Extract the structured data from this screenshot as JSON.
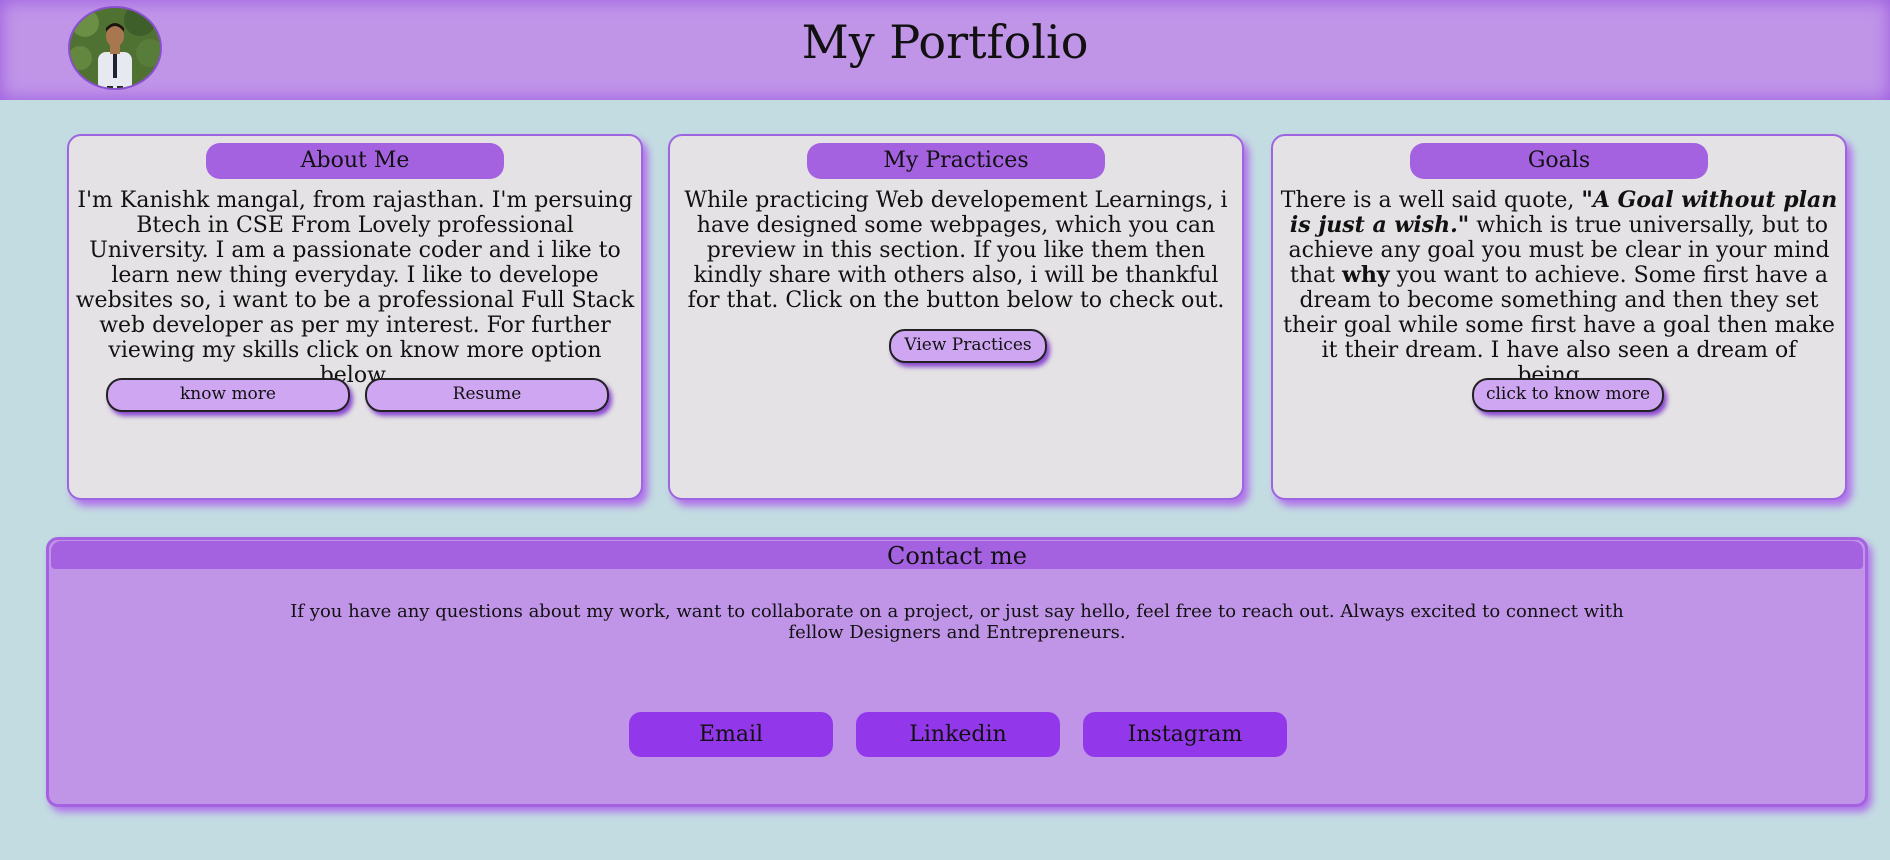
{
  "header": {
    "title": "My Portfolio"
  },
  "cards": [
    {
      "title": "About Me",
      "text": "I'm Kanishk mangal, from rajasthan. I'm persuing Btech in CSE From Lovely professional University. I am a passionate coder and i like to learn new thing everyday. I like to develope websites so, i want to be a professional Full Stack web developer as per my interest. For further viewing my skills click on know more option below.",
      "buttons": [
        "know more",
        "Resume"
      ]
    },
    {
      "title": "My Practices",
      "text": "While practicing Web developement Learnings, i have designed some webpages, which you can preview in this section. If you like them then kindly share with others also, i will be thankful for that. Click on the button below to check out.",
      "buttons": [
        "View Practices"
      ]
    },
    {
      "title": "Goals",
      "text_before": "There is a well said quote, ",
      "quote": "\"A Goal without plan is just a wish.\"",
      "text_middle": " which is true universally, but to achieve any goal you must be clear in your mind that ",
      "emphasis": "why",
      "text_after": " you want to achieve. Some first have a dream to become something and then they set their goal while some first have a goal then make it their dream. I have also seen a dream of being...",
      "buttons": [
        "click to know more"
      ]
    }
  ],
  "contact": {
    "title": "Contact me",
    "text": "If you have any questions about my work, want to collaborate on a project, or just say hello, feel free to reach out. Always excited to connect with fellow Designers and Entrepreneurs.",
    "buttons": [
      "Email",
      "Linkedin",
      "Instagram"
    ]
  }
}
